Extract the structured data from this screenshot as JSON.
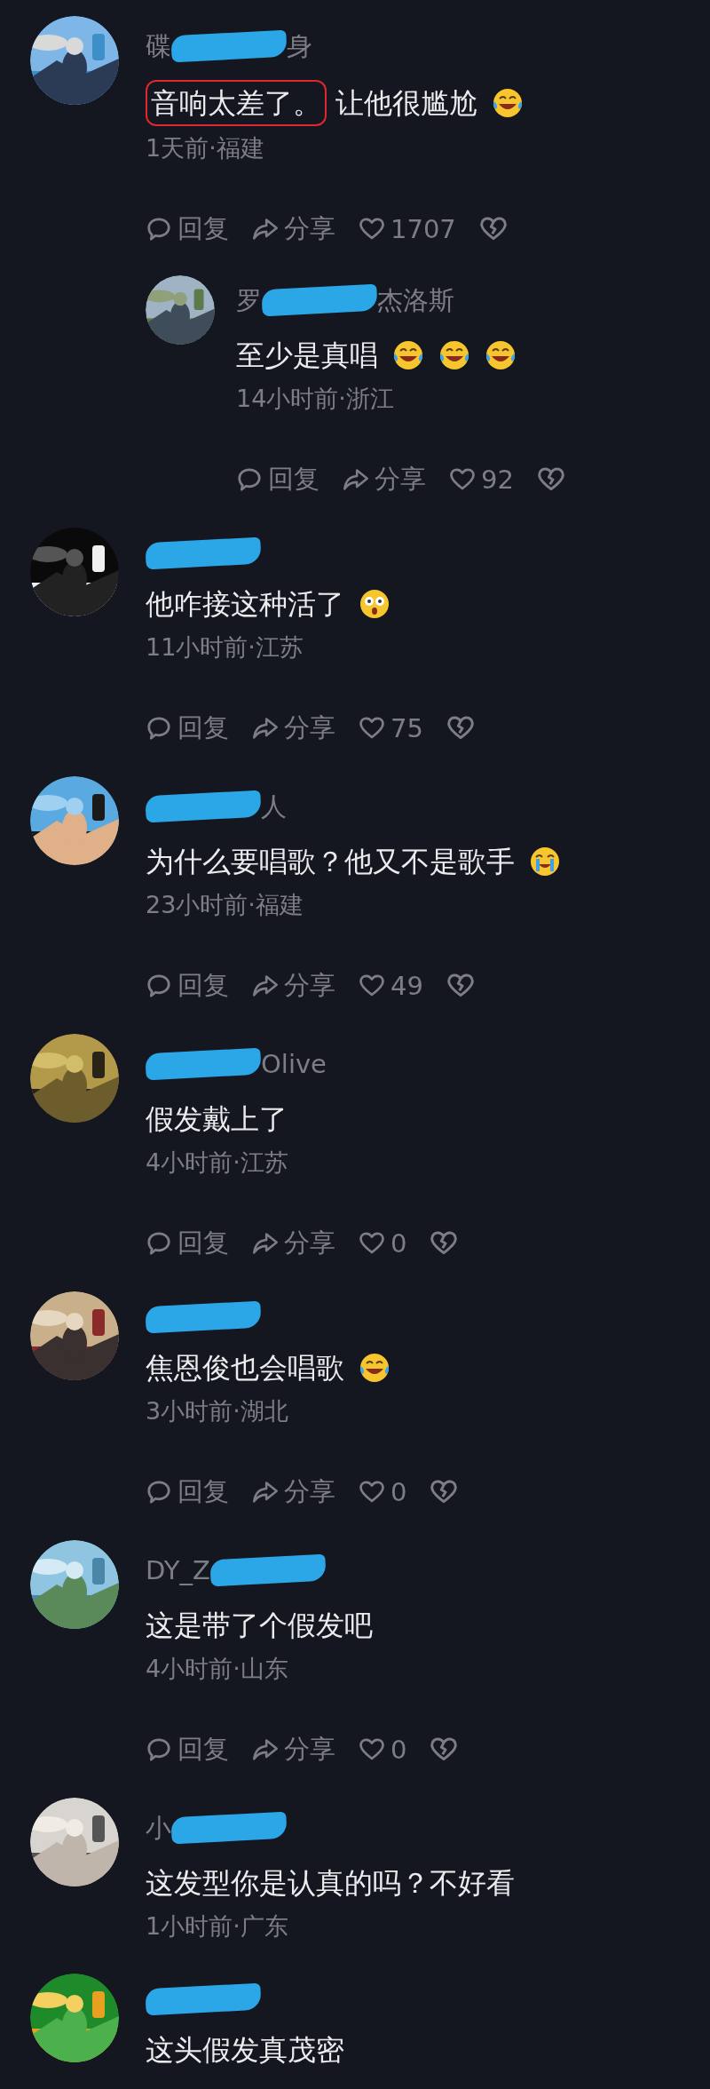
{
  "comments": [
    {
      "name": {
        "before": "碟",
        "after": "身"
      },
      "highlight": "音响太差了。",
      "text": "让他很尴尬",
      "emojis": [
        {
          "kind": "laugh-cry"
        }
      ],
      "meta": "1天前·福建",
      "actions": {
        "reply": "回复",
        "share": "分享",
        "likes": "1707"
      },
      "replies": [
        {
          "name": {
            "before": "罗",
            "after": "杰洛斯"
          },
          "text": "至少是真唱",
          "emojis": [
            {
              "kind": "laugh-cry"
            },
            {
              "kind": "laugh-cry"
            },
            {
              "kind": "laugh-cry"
            }
          ],
          "meta": "14小时前·浙江",
          "actions": {
            "reply": "回复",
            "share": "分享",
            "likes": "92"
          }
        }
      ]
    },
    {
      "text": "他咋接这种活了",
      "emojis": [
        {
          "kind": "stunned"
        }
      ],
      "meta": "11小时前·江苏",
      "actions": {
        "reply": "回复",
        "share": "分享",
        "likes": "75"
      }
    },
    {
      "name": {
        "after": "人"
      },
      "text": "为什么要唱歌？他又不是歌手",
      "emojis": [
        {
          "kind": "sob"
        }
      ],
      "meta": "23小时前·福建",
      "actions": {
        "reply": "回复",
        "share": "分享",
        "likes": "49"
      }
    },
    {
      "name": {
        "after": "Olive"
      },
      "text": "假发戴上了",
      "meta": "4小时前·江苏",
      "actions": {
        "reply": "回复",
        "share": "分享",
        "likes": "0"
      }
    },
    {
      "text": "焦恩俊也会唱歌",
      "emojis": [
        {
          "kind": "laugh-cry"
        }
      ],
      "meta": "3小时前·湖北",
      "actions": {
        "reply": "回复",
        "share": "分享",
        "likes": "0"
      }
    },
    {
      "name": {
        "before": "DY_Z"
      },
      "text": "这是带了个假发吧",
      "meta": "4小时前·山东",
      "actions": {
        "reply": "回复",
        "share": "分享",
        "likes": "0"
      }
    },
    {
      "name": {
        "before": "小"
      },
      "text": "这发型你是认真的吗？不好看",
      "meta": "1小时前·广东"
    },
    {
      "text": "这头假发真茂密"
    }
  ]
}
